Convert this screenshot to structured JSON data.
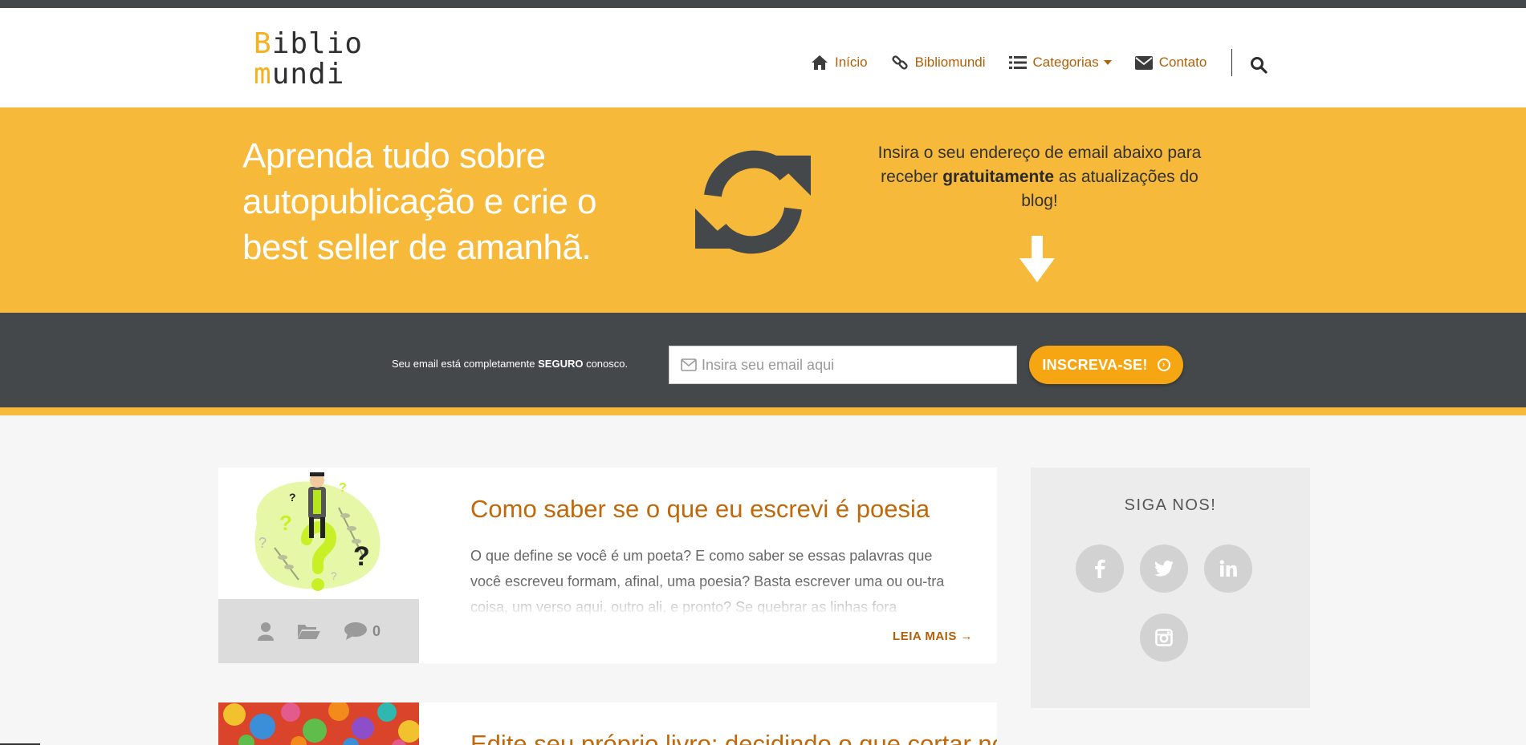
{
  "logo": {
    "line1_a": "B",
    "line1_b": "iblio",
    "line2_a": "m",
    "line2_b": "undi"
  },
  "nav": {
    "items": [
      {
        "label": "Início",
        "icon": "home-icon"
      },
      {
        "label": "Bibliomundi",
        "icon": "link-icon"
      },
      {
        "label": "Categorias",
        "icon": "list-icon"
      },
      {
        "label": "Contato",
        "icon": "envelope-icon"
      }
    ],
    "search_icon": "search-icon"
  },
  "hero": {
    "title": "Aprenda tudo sobre autopublicação e crie o best seller de amanhã.",
    "text_before": "Insira o seu endereço de email abaixo para receber ",
    "text_bold": "gratuitamente",
    "text_after": " as atualizações do blog!",
    "icon": "refresh-icon"
  },
  "signup": {
    "note_before": "Seu email está completamente ",
    "note_bold": "SEGURO",
    "note_after": " conosco.",
    "placeholder": "Insira seu email aqui",
    "button": "INSCREVA-SE!"
  },
  "posts": [
    {
      "title": "Como saber se o que eu escrevi é poesia",
      "excerpt": "O que define se você é um poeta? E como saber se essas palavras que você escreveu formam, afinal, uma poesia? Basta escrever uma ou ou-tra coisa, um verso aqui, outro ali, e pronto? Se quebrar as linhas fora",
      "comments": "0",
      "read_more": "LEIA MAIS →"
    },
    {
      "title": "Edite seu próprio livro: decidindo o que cortar no"
    }
  ],
  "sidebar": {
    "title": "SIGA NOS!",
    "social": [
      "facebook-icon",
      "twitter-icon",
      "linkedin-icon",
      "instagram-icon"
    ]
  },
  "colors": {
    "accent": "#f7b93a",
    "dark": "#45484b",
    "link": "#b25f07",
    "button": "#f5a612"
  }
}
